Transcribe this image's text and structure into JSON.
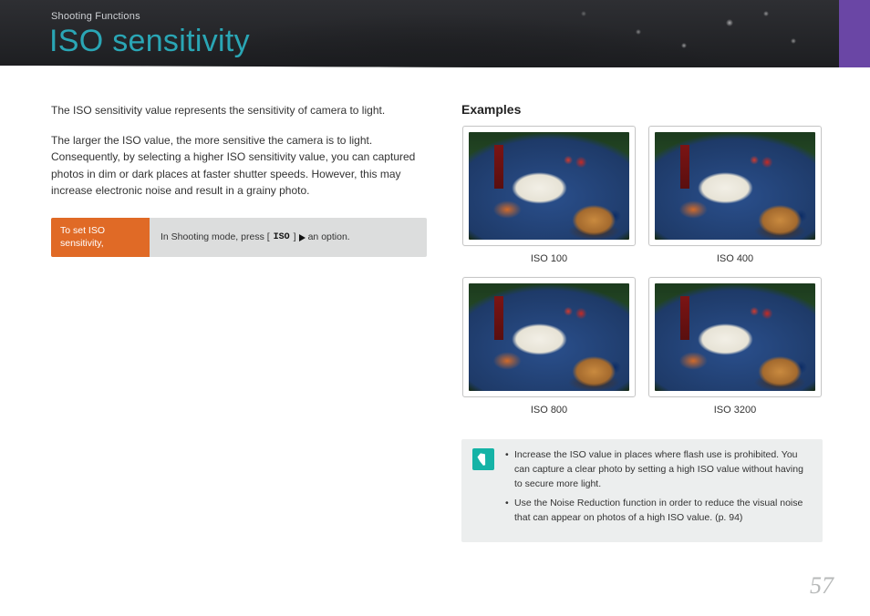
{
  "header": {
    "breadcrumb": "Shooting Functions",
    "title": "ISO sensitivity"
  },
  "intro": {
    "p1": "The ISO sensitivity value represents the sensitivity of camera to light.",
    "p2": "The larger the ISO value, the more sensitive the camera is to light. Consequently, by selecting a higher ISO sensitivity value, you can captured photos in dim or dark places at faster shutter speeds. However, this may increase electronic noise and result in a grainy photo."
  },
  "setBox": {
    "label": "To set ISO sensitivity,",
    "preText": "In Shooting mode, press [",
    "isoGlyph": "ISO",
    "midText": "] ",
    "postText": " an option."
  },
  "examples": {
    "heading": "Examples",
    "items": [
      {
        "caption": "ISO 100"
      },
      {
        "caption": "ISO 400"
      },
      {
        "caption": "ISO 800"
      },
      {
        "caption": "ISO 3200"
      }
    ]
  },
  "tips": {
    "t1": "Increase the ISO value in places where flash use is prohibited. You can capture a clear photo by setting a high ISO value without having to secure more light.",
    "t2": "Use the Noise Reduction function in order to reduce the visual noise that can appear on photos of a high ISO value. (p. 94)"
  },
  "pageNumber": "57"
}
